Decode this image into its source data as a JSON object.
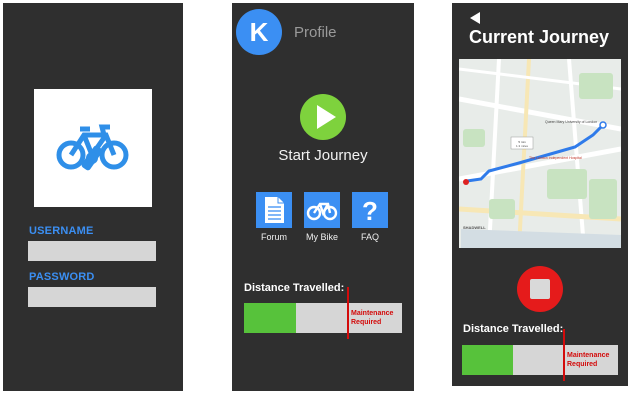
{
  "login": {
    "username_label": "USERNAME",
    "password_label": "PASSWORD",
    "username_value": "",
    "password_value": ""
  },
  "home": {
    "avatar_initial": "K",
    "profile_label": "Profile",
    "start_label": "Start Journey",
    "tiles": [
      {
        "label": "Forum",
        "icon": "document-icon"
      },
      {
        "label": "My Bike",
        "icon": "bicycle-icon"
      },
      {
        "label": "FAQ",
        "icon": "question-icon"
      }
    ],
    "distance_label": "Distance Travelled:",
    "distance_progress": 0.33,
    "maintenance_label_1": "Maintenance",
    "maintenance_label_2": "Required"
  },
  "journey": {
    "title": "Current Journey",
    "distance_label": "Distance Travelled:",
    "distance_progress": 0.33,
    "maintenance_label_1": "Maintenance",
    "maintenance_label_2": "Required",
    "map_labels": [
      "5 min",
      "1.3 miles",
      "Queen Mary University of London",
      "The London Independent Hospital",
      "SHADWELL"
    ]
  },
  "colors": {
    "screen_bg": "#2f2f2f",
    "accent_blue": "#3b8ff3",
    "play_green": "#7ed23d",
    "stop_red": "#e51b1b",
    "progress_green": "#57c23b",
    "warning_red": "#d30b0b"
  }
}
